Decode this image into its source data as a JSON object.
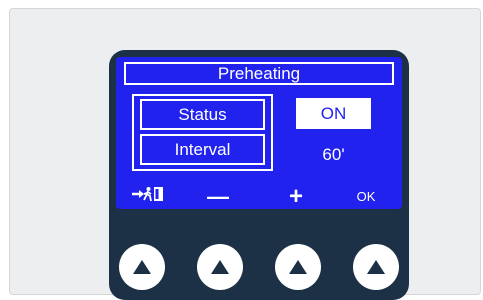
{
  "screen": {
    "title": "Preheating",
    "rows": [
      {
        "label": "Status",
        "value": "ON"
      },
      {
        "label": "Interval",
        "value": "60'"
      }
    ],
    "softkeys": {
      "exit_icon": "exit-icon",
      "minus": "—",
      "plus": "+",
      "ok": "OK"
    }
  },
  "buttons": [
    {
      "name": "softkey-1",
      "icon": "triangle-up-icon"
    },
    {
      "name": "softkey-2",
      "icon": "triangle-up-icon"
    },
    {
      "name": "softkey-3",
      "icon": "triangle-up-icon"
    },
    {
      "name": "softkey-4",
      "icon": "triangle-up-icon"
    }
  ],
  "colors": {
    "screen_blue": "#2222ee",
    "device_navy": "#1c3046",
    "panel_gray": "#eceef0"
  }
}
